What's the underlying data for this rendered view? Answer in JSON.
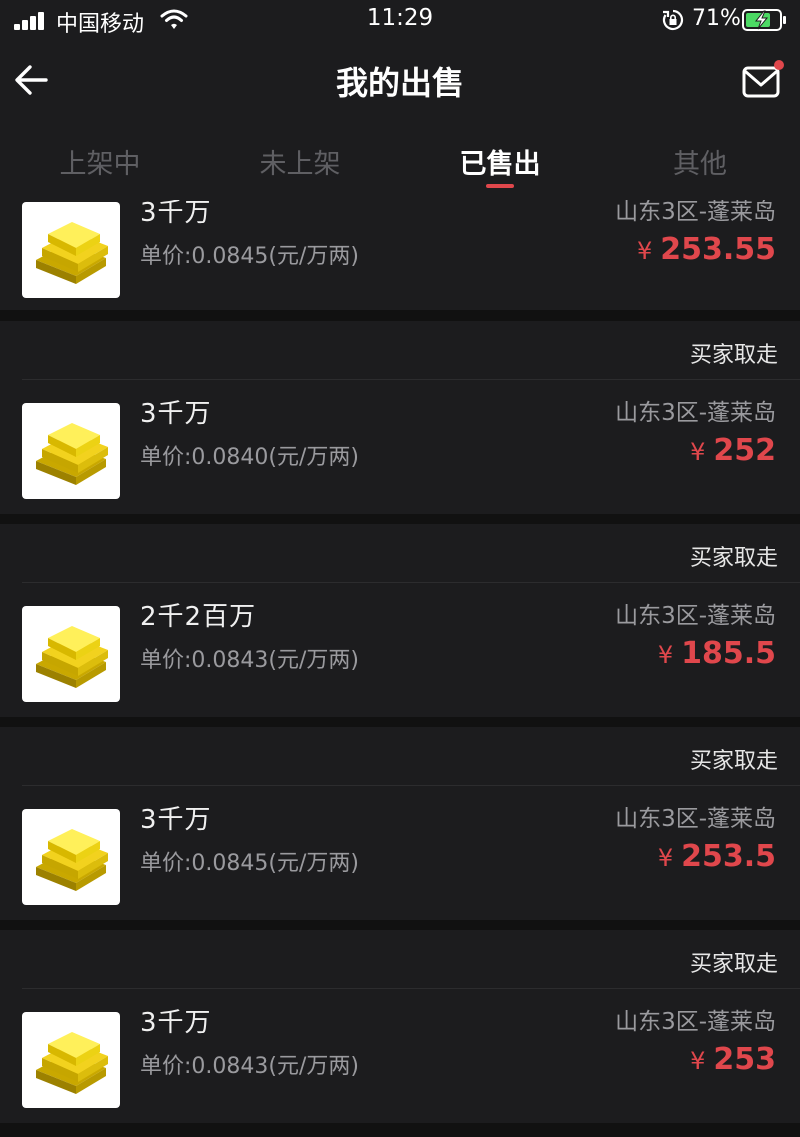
{
  "status_bar": {
    "carrier": "中国移动",
    "time": "11:29",
    "battery": "71%"
  },
  "nav": {
    "title": "我的出售",
    "back_icon": "arrow-left-icon",
    "mail_icon": "mail-icon",
    "has_notification": true
  },
  "tabs": [
    {
      "label": "上架中",
      "active": false
    },
    {
      "label": "未上架",
      "active": false
    },
    {
      "label": "已售出",
      "active": true
    },
    {
      "label": "其他",
      "active": false
    }
  ],
  "orders": [
    {
      "status": "",
      "title": "3千万",
      "unit_price": "单价:0.0845(元/万两)",
      "server": "山东3区-蓬莱岛",
      "currency": "¥",
      "price": "253.55"
    },
    {
      "status": "买家取走",
      "title": "3千万",
      "unit_price": "单价:0.0840(元/万两)",
      "server": "山东3区-蓬莱岛",
      "currency": "¥",
      "price": "252"
    },
    {
      "status": "买家取走",
      "title": "2千2百万",
      "unit_price": "单价:0.0843(元/万两)",
      "server": "山东3区-蓬莱岛",
      "currency": "¥",
      "price": "185.5"
    },
    {
      "status": "买家取走",
      "title": "3千万",
      "unit_price": "单价:0.0845(元/万两)",
      "server": "山东3区-蓬莱岛",
      "currency": "¥",
      "price": "253.5"
    },
    {
      "status": "买家取走",
      "title": "3千万",
      "unit_price": "单价:0.0843(元/万两)",
      "server": "山东3区-蓬莱岛",
      "currency": "¥",
      "price": "253"
    }
  ],
  "colors": {
    "accent": "#e0474c",
    "background": "#111111",
    "card": "#1c1c1e"
  }
}
